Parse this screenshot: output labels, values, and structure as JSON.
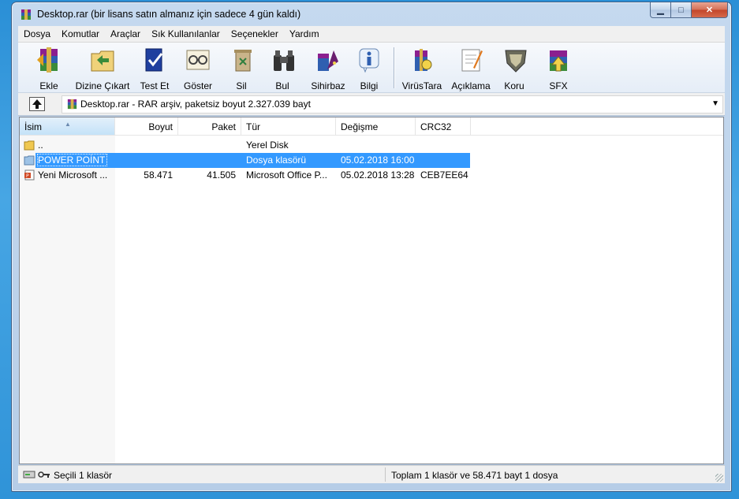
{
  "window": {
    "title": "Desktop.rar (bir lisans satın almanız için sadece 4 gün kaldı)"
  },
  "menu": [
    "Dosya",
    "Komutlar",
    "Araçlar",
    "Sık Kullanılanlar",
    "Seçenekler",
    "Yardım"
  ],
  "toolbar": {
    "add": "Ekle",
    "extract": "Dizine Çıkart",
    "test": "Test Et",
    "view": "Göster",
    "delete": "Sil",
    "find": "Bul",
    "wizard": "Sihirbaz",
    "info": "Bilgi",
    "virus": "VirüsTara",
    "comment": "Açıklama",
    "protect": "Koru",
    "sfx": "SFX"
  },
  "address": {
    "text": "Desktop.rar - RAR arşiv, paketsiz boyut 2.327.039 bayt"
  },
  "columns": {
    "name": "İsim",
    "size": "Boyut",
    "packed": "Paket",
    "type": "Tür",
    "modified": "Değişme",
    "crc": "CRC32"
  },
  "files": [
    {
      "name": "..",
      "size": "",
      "packed": "",
      "type": "Yerel Disk",
      "modified": "",
      "crc": "",
      "icon": "folder-up-icon"
    },
    {
      "name": "POWER POİNT",
      "size": "",
      "packed": "",
      "type": "Dosya klasörü",
      "modified": "05.02.2018 16:00",
      "crc": "",
      "icon": "folder-icon",
      "selected": true
    },
    {
      "name": "Yeni Microsoft ...",
      "size": "58.471",
      "packed": "41.505",
      "type": "Microsoft Office P...",
      "modified": "05.02.2018 13:28",
      "crc": "CEB7EE64",
      "icon": "powerpoint-file-icon"
    }
  ],
  "status": {
    "left": "Seçili 1 klasör",
    "right": "Toplam 1 klasör ve 58.471 bayt 1 dosya"
  },
  "colors": {
    "selection": "#3399ff",
    "window_frame": "#c5d9ef",
    "desktop": "#2a8fd6"
  }
}
